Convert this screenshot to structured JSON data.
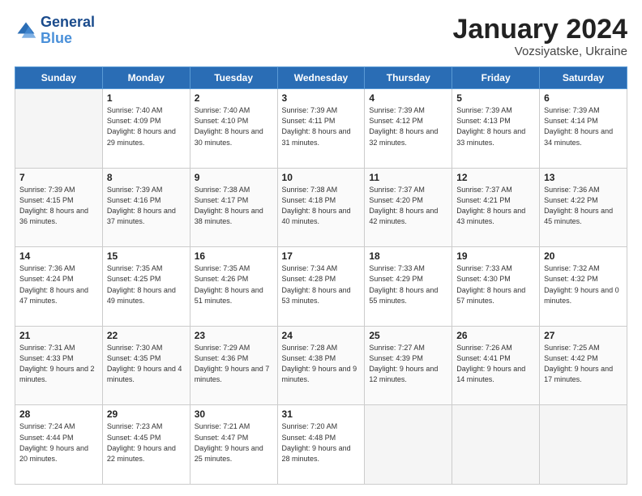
{
  "header": {
    "logo_line1": "General",
    "logo_line2": "Blue",
    "title": "January 2024",
    "subtitle": "Vozsiyatske, Ukraine"
  },
  "days_of_week": [
    "Sunday",
    "Monday",
    "Tuesday",
    "Wednesday",
    "Thursday",
    "Friday",
    "Saturday"
  ],
  "weeks": [
    [
      {
        "day": "",
        "empty": true
      },
      {
        "day": "1",
        "sunrise": "7:40 AM",
        "sunset": "4:09 PM",
        "daylight": "8 hours and 29 minutes."
      },
      {
        "day": "2",
        "sunrise": "7:40 AM",
        "sunset": "4:10 PM",
        "daylight": "8 hours and 30 minutes."
      },
      {
        "day": "3",
        "sunrise": "7:39 AM",
        "sunset": "4:11 PM",
        "daylight": "8 hours and 31 minutes."
      },
      {
        "day": "4",
        "sunrise": "7:39 AM",
        "sunset": "4:12 PM",
        "daylight": "8 hours and 32 minutes."
      },
      {
        "day": "5",
        "sunrise": "7:39 AM",
        "sunset": "4:13 PM",
        "daylight": "8 hours and 33 minutes."
      },
      {
        "day": "6",
        "sunrise": "7:39 AM",
        "sunset": "4:14 PM",
        "daylight": "8 hours and 34 minutes."
      }
    ],
    [
      {
        "day": "7",
        "sunrise": "7:39 AM",
        "sunset": "4:15 PM",
        "daylight": "8 hours and 36 minutes."
      },
      {
        "day": "8",
        "sunrise": "7:39 AM",
        "sunset": "4:16 PM",
        "daylight": "8 hours and 37 minutes."
      },
      {
        "day": "9",
        "sunrise": "7:38 AM",
        "sunset": "4:17 PM",
        "daylight": "8 hours and 38 minutes."
      },
      {
        "day": "10",
        "sunrise": "7:38 AM",
        "sunset": "4:18 PM",
        "daylight": "8 hours and 40 minutes."
      },
      {
        "day": "11",
        "sunrise": "7:37 AM",
        "sunset": "4:20 PM",
        "daylight": "8 hours and 42 minutes."
      },
      {
        "day": "12",
        "sunrise": "7:37 AM",
        "sunset": "4:21 PM",
        "daylight": "8 hours and 43 minutes."
      },
      {
        "day": "13",
        "sunrise": "7:36 AM",
        "sunset": "4:22 PM",
        "daylight": "8 hours and 45 minutes."
      }
    ],
    [
      {
        "day": "14",
        "sunrise": "7:36 AM",
        "sunset": "4:24 PM",
        "daylight": "8 hours and 47 minutes."
      },
      {
        "day": "15",
        "sunrise": "7:35 AM",
        "sunset": "4:25 PM",
        "daylight": "8 hours and 49 minutes."
      },
      {
        "day": "16",
        "sunrise": "7:35 AM",
        "sunset": "4:26 PM",
        "daylight": "8 hours and 51 minutes."
      },
      {
        "day": "17",
        "sunrise": "7:34 AM",
        "sunset": "4:28 PM",
        "daylight": "8 hours and 53 minutes."
      },
      {
        "day": "18",
        "sunrise": "7:33 AM",
        "sunset": "4:29 PM",
        "daylight": "8 hours and 55 minutes."
      },
      {
        "day": "19",
        "sunrise": "7:33 AM",
        "sunset": "4:30 PM",
        "daylight": "8 hours and 57 minutes."
      },
      {
        "day": "20",
        "sunrise": "7:32 AM",
        "sunset": "4:32 PM",
        "daylight": "9 hours and 0 minutes."
      }
    ],
    [
      {
        "day": "21",
        "sunrise": "7:31 AM",
        "sunset": "4:33 PM",
        "daylight": "9 hours and 2 minutes."
      },
      {
        "day": "22",
        "sunrise": "7:30 AM",
        "sunset": "4:35 PM",
        "daylight": "9 hours and 4 minutes."
      },
      {
        "day": "23",
        "sunrise": "7:29 AM",
        "sunset": "4:36 PM",
        "daylight": "9 hours and 7 minutes."
      },
      {
        "day": "24",
        "sunrise": "7:28 AM",
        "sunset": "4:38 PM",
        "daylight": "9 hours and 9 minutes."
      },
      {
        "day": "25",
        "sunrise": "7:27 AM",
        "sunset": "4:39 PM",
        "daylight": "9 hours and 12 minutes."
      },
      {
        "day": "26",
        "sunrise": "7:26 AM",
        "sunset": "4:41 PM",
        "daylight": "9 hours and 14 minutes."
      },
      {
        "day": "27",
        "sunrise": "7:25 AM",
        "sunset": "4:42 PM",
        "daylight": "9 hours and 17 minutes."
      }
    ],
    [
      {
        "day": "28",
        "sunrise": "7:24 AM",
        "sunset": "4:44 PM",
        "daylight": "9 hours and 20 minutes."
      },
      {
        "day": "29",
        "sunrise": "7:23 AM",
        "sunset": "4:45 PM",
        "daylight": "9 hours and 22 minutes."
      },
      {
        "day": "30",
        "sunrise": "7:21 AM",
        "sunset": "4:47 PM",
        "daylight": "9 hours and 25 minutes."
      },
      {
        "day": "31",
        "sunrise": "7:20 AM",
        "sunset": "4:48 PM",
        "daylight": "9 hours and 28 minutes."
      },
      {
        "day": "",
        "empty": true
      },
      {
        "day": "",
        "empty": true
      },
      {
        "day": "",
        "empty": true
      }
    ]
  ],
  "labels": {
    "sunrise": "Sunrise:",
    "sunset": "Sunset:",
    "daylight": "Daylight:"
  }
}
